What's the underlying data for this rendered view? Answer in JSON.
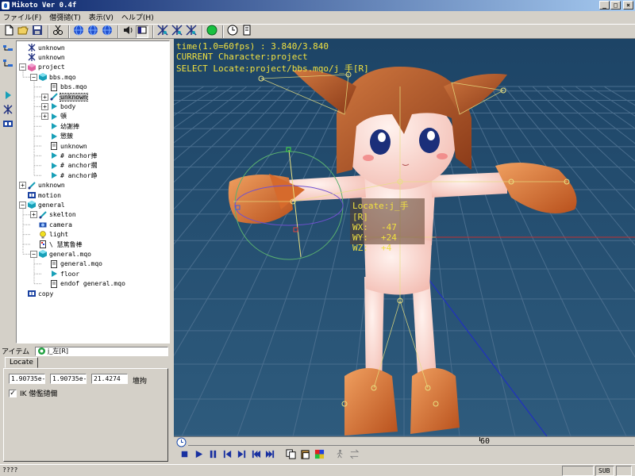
{
  "window": {
    "title": "Mikoto Ver 0.4f",
    "min_label": "_",
    "max_label": "□",
    "close_label": "×"
  },
  "menu": [
    "ファイル(F)",
    "僣彁擿(T)",
    "表示(V)",
    "ヘルプ(H)"
  ],
  "toolbar": {
    "icons": [
      "new-file-icon",
      "open-folder-icon",
      "save-icon",
      "sep",
      "cut-icon",
      "sep",
      "globe-blue-icon",
      "globe-blue-2-icon",
      "globe-blue-3-icon",
      "sep",
      "speaker-icon",
      "rect-icon",
      "sep",
      "bone-star-icon",
      "bone-star-2-icon",
      "bone-star-3-icon",
      "sep",
      "green-circle-icon",
      "sep",
      "clock-icon",
      "page-icon"
    ]
  },
  "tree": {
    "items": [
      {
        "label": "unknown",
        "icon": "bone-star",
        "depth": 0,
        "exp": ""
      },
      {
        "label": "unknown",
        "icon": "bone-star",
        "depth": 0,
        "exp": ""
      },
      {
        "label": "project",
        "icon": "cube-pink",
        "depth": 0,
        "exp": "−"
      },
      {
        "label": "bbs.mqo",
        "icon": "cube-teal",
        "depth": 1,
        "exp": "−"
      },
      {
        "label": "bbs.mqo",
        "icon": "page",
        "depth": 2,
        "exp": ""
      },
      {
        "label": "unknown",
        "icon": "bone-cyan",
        "depth": 2,
        "exp": "+",
        "selected": true
      },
      {
        "label": "body",
        "icon": "arrow-cyan",
        "depth": 2,
        "exp": "+"
      },
      {
        "label": "頓",
        "icon": "arrow-cyan",
        "depth": 2,
        "exp": "+"
      },
      {
        "label": "幼謝捧",
        "icon": "arrow-cyan",
        "depth": 2,
        "exp": ""
      },
      {
        "label": "懲皷",
        "icon": "arrow-cyan",
        "depth": 2,
        "exp": ""
      },
      {
        "label": "unknown",
        "icon": "page",
        "depth": 2,
        "exp": ""
      },
      {
        "label": "# anchor捧",
        "icon": "arrow-cyan",
        "depth": 2,
        "exp": ""
      },
      {
        "label": "# anchor擱",
        "icon": "arrow-cyan",
        "depth": 2,
        "exp": ""
      },
      {
        "label": "# anchor峥",
        "icon": "arrow-cyan",
        "depth": 2,
        "exp": ""
      },
      {
        "label": "unknown",
        "icon": "bone-cyan",
        "depth": 0,
        "exp": "+"
      },
      {
        "label": "motion",
        "icon": "film",
        "depth": 0,
        "exp": ""
      },
      {
        "label": "general",
        "icon": "cube-teal",
        "depth": 0,
        "exp": "−"
      },
      {
        "label": "skelton",
        "icon": "bone-cyan",
        "depth": 1,
        "exp": "+"
      },
      {
        "label": "camera",
        "icon": "camera",
        "depth": 1,
        "exp": ""
      },
      {
        "label": "light",
        "icon": "bulb",
        "depth": 1,
        "exp": ""
      },
      {
        "label": "\\ 慧篤鲁棒",
        "icon": "page-color",
        "depth": 1,
        "exp": ""
      },
      {
        "label": "general.mqo",
        "icon": "cube-teal",
        "depth": 1,
        "exp": "−"
      },
      {
        "label": "general.mqo",
        "icon": "page",
        "depth": 2,
        "exp": ""
      },
      {
        "label": "floor",
        "icon": "arrow-cyan",
        "depth": 2,
        "exp": ""
      },
      {
        "label": "endof general.mqo",
        "icon": "page",
        "depth": 2,
        "exp": ""
      },
      {
        "label": "copy",
        "icon": "film",
        "depth": 0,
        "exp": ""
      }
    ]
  },
  "props": {
    "item_label": "アイテム",
    "item_value": "j_左[R]",
    "tab": "Locate",
    "fields": [
      "1.90735e-",
      "1.90735e-",
      "21.4274"
    ],
    "unit": "壇拘",
    "checkbox_checked": true,
    "checkbox_label": "IK 僣儖擿儞"
  },
  "viewport": {
    "hud": [
      "time(1.0=60fps) : 3.840/3.840",
      "CURRENT Character:project",
      "SELECT Locate:project/bbs.mqo/j_手[R]"
    ],
    "coord_title": "Locate:j_手[R]",
    "coords": [
      {
        "k": "WX:",
        "v": "-47"
      },
      {
        "k": "WY:",
        "v": "+24"
      },
      {
        "k": "WZ:",
        "v": "+4"
      }
    ],
    "colors": {
      "background": "#2b5577",
      "hud": "#f0e040",
      "grid": "#4a6e8e",
      "skin": "#fbd8cf",
      "hair": "#b8562a",
      "glove": "#e07a3a"
    }
  },
  "timeline": {
    "label": "60",
    "position_fraction": 0.69
  },
  "playbar": {
    "icons": [
      "stop-icon",
      "play-icon",
      "pause-icon",
      "step-back-icon",
      "step-forward-icon",
      "to-start-icon",
      "to-end-icon",
      "sep",
      "copy-icon",
      "paste-icon",
      "palette-icon",
      "sep",
      "walk-icon",
      "swap-icon"
    ]
  },
  "status": {
    "left": "????",
    "mode": "SUB"
  }
}
